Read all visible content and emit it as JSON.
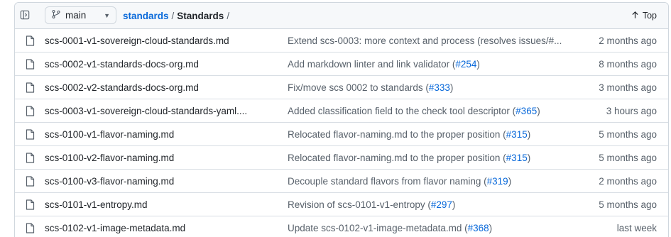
{
  "header": {
    "branch_icon": "git-branch-icon",
    "branch_name": "main",
    "breadcrumb": {
      "repo": "standards",
      "separator": "/",
      "current": "Standards",
      "trailing_separator": "/"
    },
    "top_label": "Top",
    "top_icon": "arrow-up-icon",
    "sidebar_icon": "sidebar-expand-icon"
  },
  "files": [
    {
      "name": "scs-0001-v1-sovereign-cloud-standards.md",
      "message": "Extend scs-0003: more context and process (resolves issues/#...",
      "message_pre": "",
      "pr": "",
      "message_post": "",
      "age": "2 months ago"
    },
    {
      "name": "scs-0002-v1-standards-docs-org.md",
      "message": "",
      "message_pre": "Add markdown linter and link validator (",
      "pr": "#254",
      "message_post": ")",
      "age": "8 months ago"
    },
    {
      "name": "scs-0002-v2-standards-docs-org.md",
      "message": "",
      "message_pre": "Fix/move scs 0002 to standards (",
      "pr": "#333",
      "message_post": ")",
      "age": "3 months ago"
    },
    {
      "name": "scs-0003-v1-sovereign-cloud-standards-yaml....",
      "message": "",
      "message_pre": "Added classification field to the check tool descriptor (",
      "pr": "#365",
      "message_post": ")",
      "age": "3 hours ago"
    },
    {
      "name": "scs-0100-v1-flavor-naming.md",
      "message": "",
      "message_pre": "Relocated flavor-naming.md to the proper position (",
      "pr": "#315",
      "message_post": ")",
      "age": "5 months ago"
    },
    {
      "name": "scs-0100-v2-flavor-naming.md",
      "message": "",
      "message_pre": "Relocated flavor-naming.md to the proper position (",
      "pr": "#315",
      "message_post": ")",
      "age": "5 months ago"
    },
    {
      "name": "scs-0100-v3-flavor-naming.md",
      "message": "",
      "message_pre": "Decouple standard flavors from flavor naming (",
      "pr": "#319",
      "message_post": ")",
      "age": "2 months ago"
    },
    {
      "name": "scs-0101-v1-entropy.md",
      "message": "",
      "message_pre": "Revision of scs-0101-v1-entropy (",
      "pr": "#297",
      "message_post": ")",
      "age": "5 months ago"
    },
    {
      "name": "scs-0102-v1-image-metadata.md",
      "message": "",
      "message_pre": "Update scs-0102-v1-image-metadata.md (",
      "pr": "#368",
      "message_post": ")",
      "age": "last week"
    }
  ],
  "colors": {
    "link": "#0969da",
    "muted": "#57606a",
    "border": "#d0d7de",
    "header_bg": "#f6f8fa"
  }
}
